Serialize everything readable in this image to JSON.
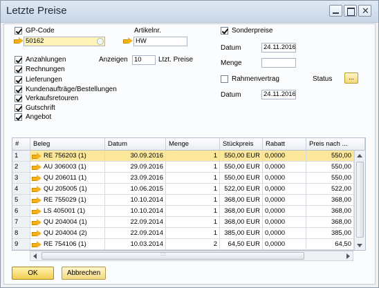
{
  "window": {
    "title": "Letzte Preise"
  },
  "left": {
    "gp_code": {
      "label": "GP-Code",
      "value": "50162",
      "checked": true
    },
    "artikel": {
      "label": "Artikelnr.",
      "value": "HW"
    },
    "anzeigen": {
      "label": "Anzeigen",
      "value": "10",
      "suffix": "Ltzt. Preise"
    },
    "options": [
      {
        "label": "Anzahlungen",
        "checked": true
      },
      {
        "label": "Rechnungen",
        "checked": true
      },
      {
        "label": "Lieferungen",
        "checked": true
      },
      {
        "label": "Kundenaufträge/Bestellungen",
        "checked": true
      },
      {
        "label": "Verkaufsretouren",
        "checked": true
      },
      {
        "label": "Gutschrift",
        "checked": true
      },
      {
        "label": "Angebot",
        "checked": true
      }
    ]
  },
  "right": {
    "sonderpreise": {
      "label": "Sonderpreise",
      "checked": true
    },
    "datum1": {
      "label": "Datum",
      "value": "24.11.2016"
    },
    "menge": {
      "label": "Menge",
      "value": ""
    },
    "rahmenvertrag": {
      "label": "Rahmenvertrag",
      "checked": false
    },
    "status": {
      "label": "Status",
      "button": "..."
    },
    "datum2": {
      "label": "Datum",
      "value": "24.11.2016"
    }
  },
  "table": {
    "columns": [
      "#",
      "Beleg",
      "Datum",
      "Menge",
      "Stückpreis",
      "Rabatt",
      "Preis nach ..."
    ],
    "rows": [
      {
        "num": "1",
        "beleg": "RE 756203 (1)",
        "datum": "30.09.2016",
        "menge": "1",
        "stueck": "550,00 EUR",
        "rabatt": "0,0000",
        "preis": "550,00"
      },
      {
        "num": "2",
        "beleg": "AU 306003 (1)",
        "datum": "29.09.2016",
        "menge": "1",
        "stueck": "550,00 EUR",
        "rabatt": "0,0000",
        "preis": "550,00"
      },
      {
        "num": "3",
        "beleg": "QU 206011 (1)",
        "datum": "23.09.2016",
        "menge": "1",
        "stueck": "550,00 EUR",
        "rabatt": "0,0000",
        "preis": "550,00"
      },
      {
        "num": "4",
        "beleg": "QU 205005 (1)",
        "datum": "10.06.2015",
        "menge": "1",
        "stueck": "522,00 EUR",
        "rabatt": "0,0000",
        "preis": "522,00"
      },
      {
        "num": "5",
        "beleg": "RE 755029 (1)",
        "datum": "10.10.2014",
        "menge": "1",
        "stueck": "368,00 EUR",
        "rabatt": "0,0000",
        "preis": "368,00"
      },
      {
        "num": "6",
        "beleg": "LS 405001 (1)",
        "datum": "10.10.2014",
        "menge": "1",
        "stueck": "368,00 EUR",
        "rabatt": "0,0000",
        "preis": "368,00"
      },
      {
        "num": "7",
        "beleg": "QU 204004 (1)",
        "datum": "22.09.2014",
        "menge": "1",
        "stueck": "368,00 EUR",
        "rabatt": "0,0000",
        "preis": "368,00"
      },
      {
        "num": "8",
        "beleg": "QU 204004 (2)",
        "datum": "22.09.2014",
        "menge": "1",
        "stueck": "385,00 EUR",
        "rabatt": "0,0000",
        "preis": "385,00"
      },
      {
        "num": "9",
        "beleg": "RE 754106 (1)",
        "datum": "10.03.2014",
        "menge": "2",
        "stueck": "64,50 EUR",
        "rabatt": "0,0000",
        "preis": "64,50"
      }
    ],
    "selected_row": 0
  },
  "footer": {
    "ok": "OK",
    "cancel": "Abbrechen"
  },
  "colors": {
    "selection": "#fde79a",
    "accent": "#f1cd4e",
    "link_arrow": "#f3b21a"
  }
}
